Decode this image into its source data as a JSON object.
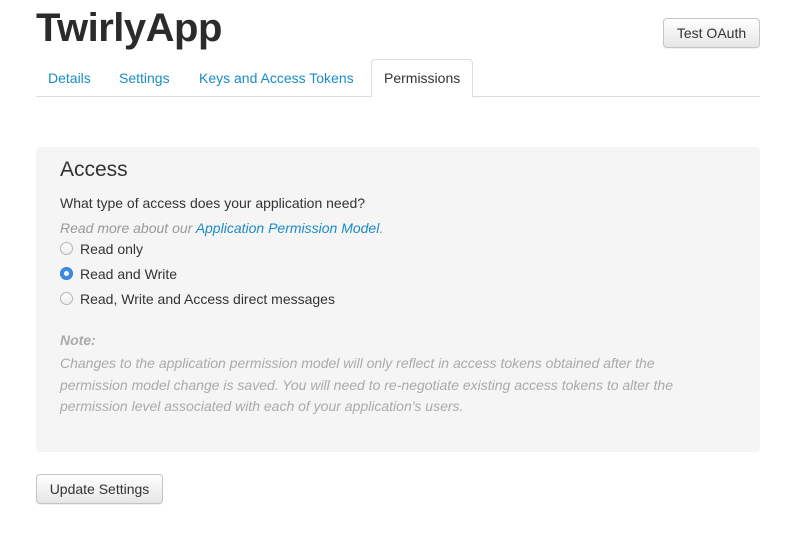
{
  "app": {
    "title": "TwirlyApp",
    "test_oauth_label": "Test OAuth"
  },
  "tabs": [
    {
      "label": "Details",
      "active": false
    },
    {
      "label": "Settings",
      "active": false
    },
    {
      "label": "Keys and Access Tokens",
      "active": false
    },
    {
      "label": "Permissions",
      "active": true
    }
  ],
  "access": {
    "heading": "Access",
    "question": "What type of access does your application need?",
    "read_more_prefix": "Read more about our ",
    "read_more_link": "Application Permission Model",
    "read_more_suffix": ".",
    "options": [
      {
        "label": "Read only",
        "selected": false
      },
      {
        "label": "Read and Write",
        "selected": true
      },
      {
        "label": "Read, Write and Access direct messages",
        "selected": false
      }
    ],
    "note_label": "Note:",
    "note_text": "Changes to the application permission model will only reflect in access tokens obtained after the permission model change is saved. You will need to re-negotiate existing access tokens to alter the permission level associated with each of your application's users."
  },
  "update_button_label": "Update Settings",
  "colors": {
    "link": "#1a8cc4",
    "radio_selected": "#3b8de0",
    "panel_background": "#f5f5f5",
    "muted_text": "#aaaaaa"
  }
}
